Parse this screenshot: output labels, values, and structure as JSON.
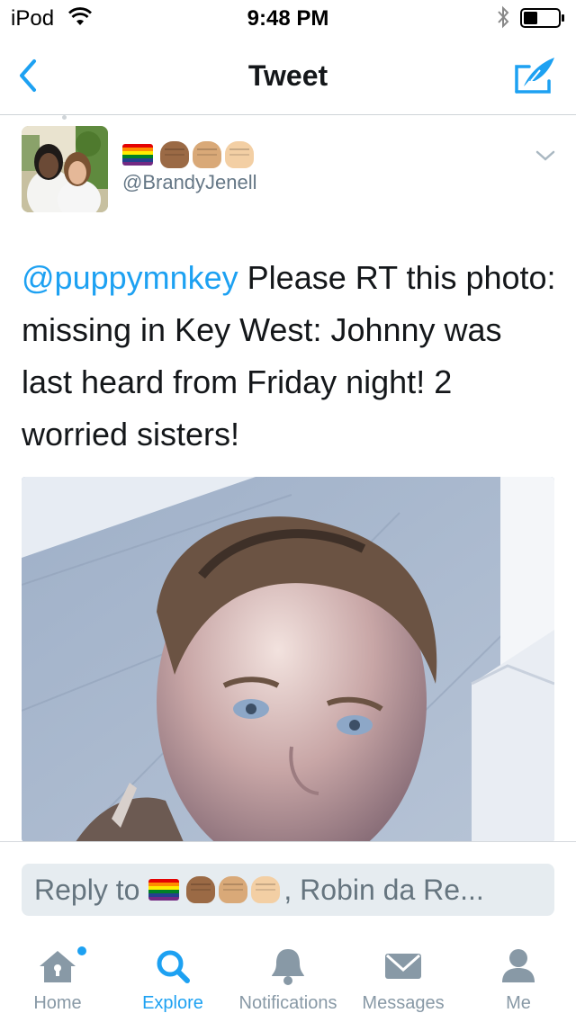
{
  "status_bar": {
    "carrier": "iPod",
    "time": "9:48 PM"
  },
  "nav": {
    "title": "Tweet",
    "back_icon": "chevron-left-icon",
    "compose_icon": "compose-quill-icon"
  },
  "tweet": {
    "handle": "@BrandyJenell",
    "display_name_emoji": [
      "rainbow-flag",
      "fist-medium-dark",
      "fist-medium-light",
      "fist-light"
    ],
    "mention": "@puppymnkey",
    "text": " Please RT this photo: missing in Key West: Johnny was last heard from Friday night!  2 worried sisters!"
  },
  "reply": {
    "prefix": "Reply to",
    "suffix": ", Robin da Re..."
  },
  "tabs": [
    {
      "label": "Home",
      "icon": "home-icon",
      "active": false,
      "has_badge": true
    },
    {
      "label": "Explore",
      "icon": "search-icon",
      "active": true,
      "has_badge": false
    },
    {
      "label": "Notifications",
      "icon": "bell-icon",
      "active": false,
      "has_badge": false
    },
    {
      "label": "Messages",
      "icon": "envelope-icon",
      "active": false,
      "has_badge": false
    },
    {
      "label": "Me",
      "icon": "person-icon",
      "active": false,
      "has_badge": false
    }
  ],
  "colors": {
    "accent": "#1da1f2",
    "text": "#14171a",
    "muted": "#8899a6",
    "reply_bg": "#e6ecf0"
  }
}
